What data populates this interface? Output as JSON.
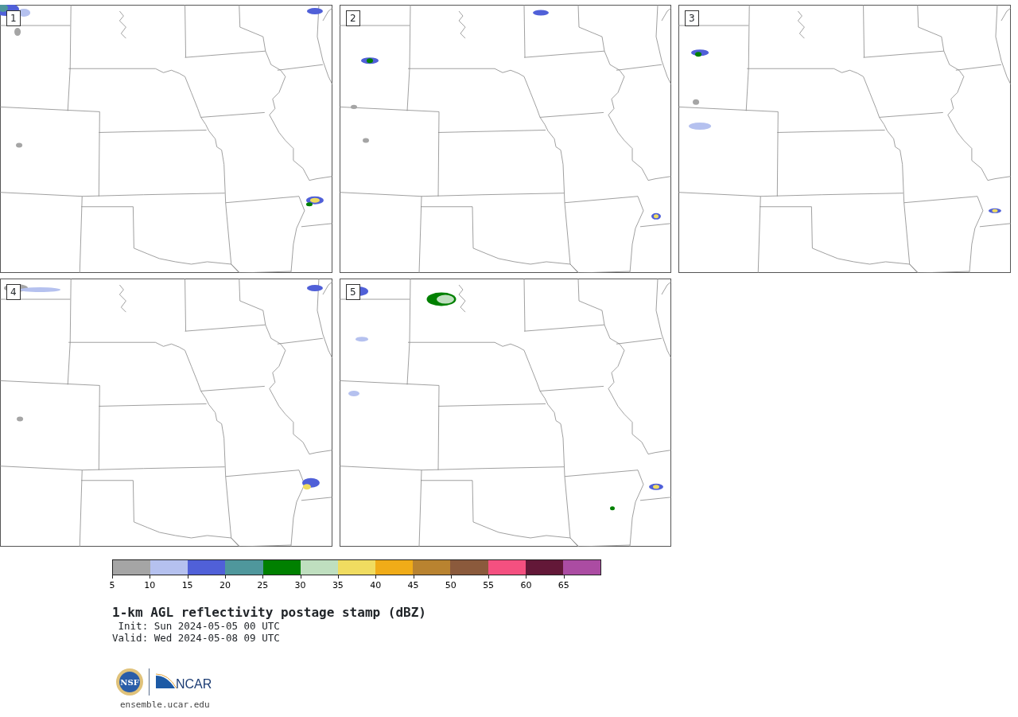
{
  "panels": [
    {
      "number": "1"
    },
    {
      "number": "2"
    },
    {
      "number": "3"
    },
    {
      "number": "4"
    },
    {
      "number": "5"
    }
  ],
  "colorbar": {
    "bins": [
      {
        "color": "#a5a5a5",
        "label": "5"
      },
      {
        "color": "#b5c1ef",
        "label": "10"
      },
      {
        "color": "#5060d8",
        "label": "15"
      },
      {
        "color": "#4f979c",
        "label": "20"
      },
      {
        "color": "#008000",
        "label": "25"
      },
      {
        "color": "#bfdfbf",
        "label": "30"
      },
      {
        "color": "#f0dc60",
        "label": "35"
      },
      {
        "color": "#f0ac18",
        "label": "40"
      },
      {
        "color": "#b98330",
        "label": "45"
      },
      {
        "color": "#8b5a3c",
        "label": "50"
      },
      {
        "color": "#f45080",
        "label": "55"
      },
      {
        "color": "#631838",
        "label": "60"
      },
      {
        "color": "#ab4ca2",
        "label": "65"
      }
    ]
  },
  "title": "1-km AGL reflectivity postage stamp (dBZ)",
  "init": " Init: Sun 2024-05-05 00 UTC",
  "valid": "Valid: Wed 2024-05-08 09 UTC",
  "logos": {
    "nsf_text": "NSF",
    "ncar_text": "NCAR"
  },
  "site_url": "ensemble.ucar.edu"
}
